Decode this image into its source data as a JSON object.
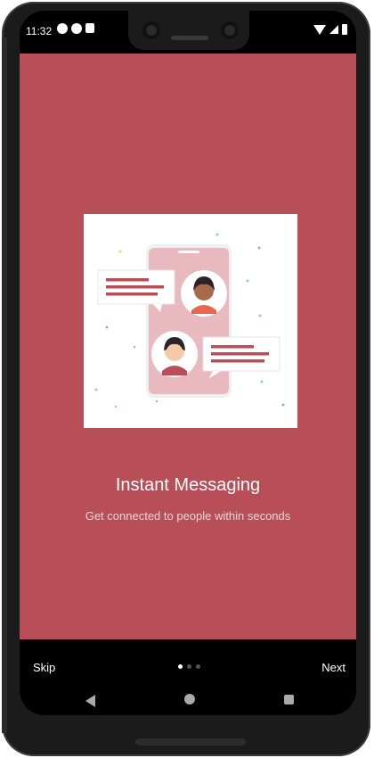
{
  "status_bar": {
    "time": "11:32"
  },
  "onboarding": {
    "title": "Instant Messaging",
    "subtitle": "Get connected to people within seconds"
  },
  "footer": {
    "skip_label": "Skip",
    "next_label": "Next",
    "page_count": 3,
    "current_page": 1
  },
  "colors": {
    "background": "#b84e57",
    "illustration_bubble_lines": "#b84e57",
    "phone_screen": "#e8b9bf"
  },
  "icons": {
    "nav_back": "back-triangle-icon",
    "nav_home": "home-circle-icon",
    "nav_recent": "recent-apps-icon"
  }
}
